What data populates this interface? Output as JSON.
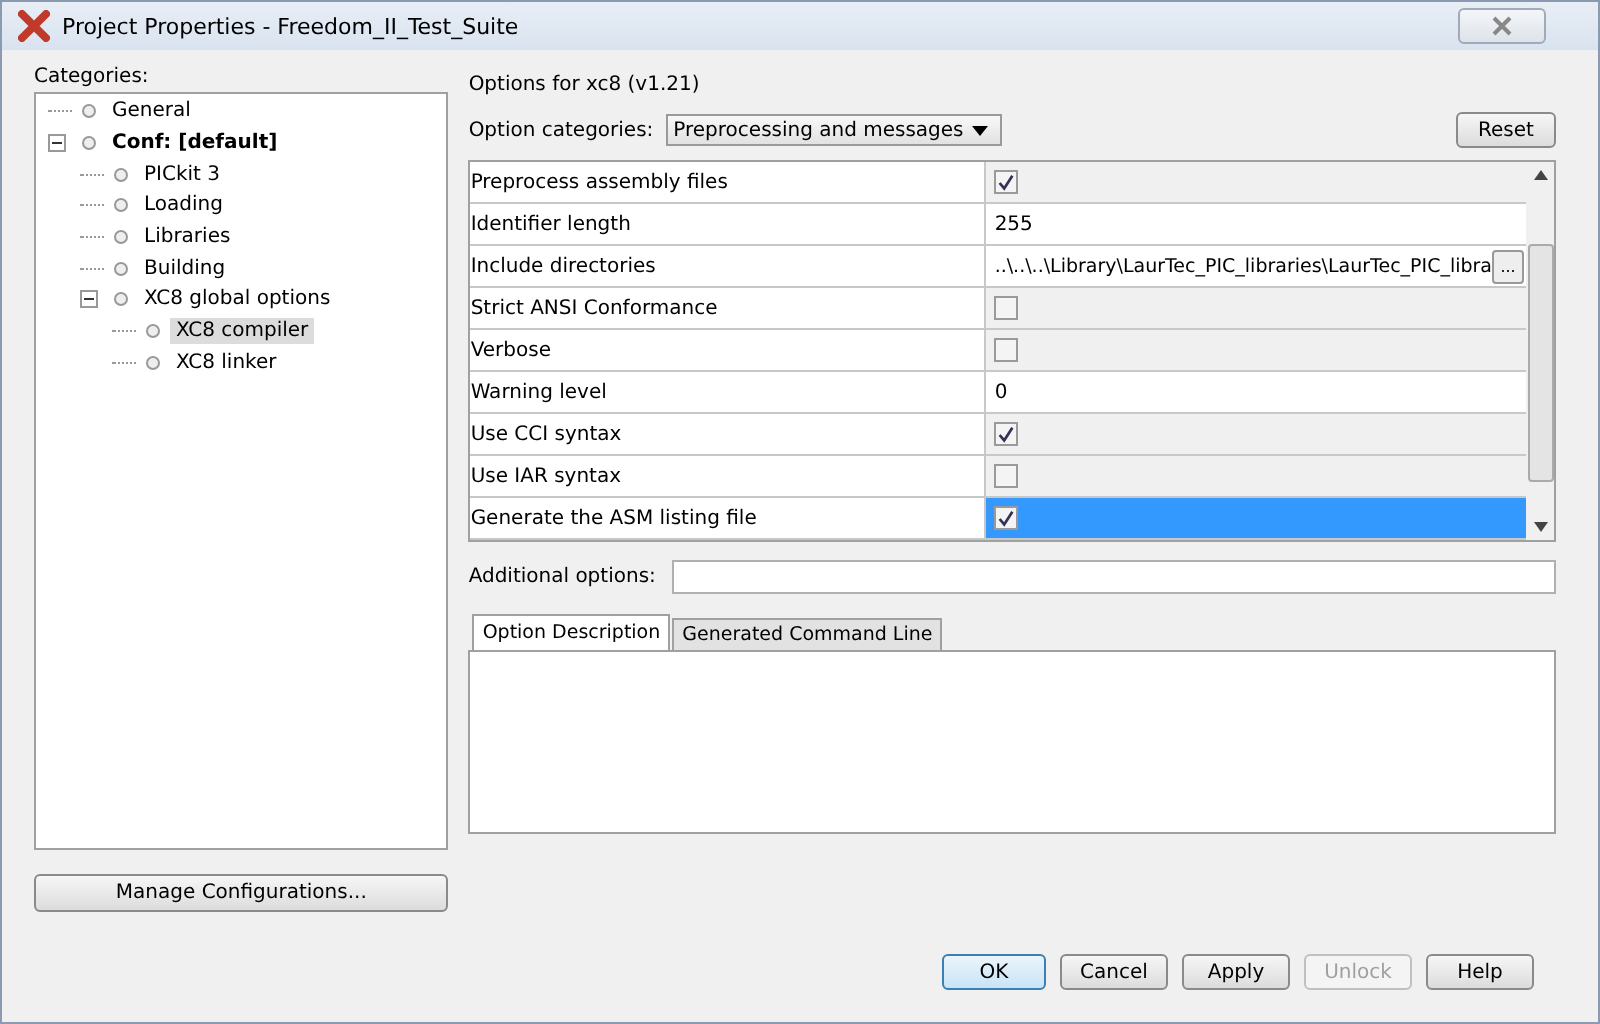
{
  "window": {
    "title": "Project Properties - Freedom_II_Test_Suite"
  },
  "categories_label": "Categories:",
  "tree": [
    {
      "label": "General",
      "bold": false,
      "selected": false
    },
    {
      "label": "Conf: [default]",
      "bold": true,
      "selected": false,
      "expanded": true,
      "children": [
        {
          "label": "PICkit 3",
          "bold": false,
          "selected": false
        },
        {
          "label": "Loading",
          "bold": false,
          "selected": false
        },
        {
          "label": "Libraries",
          "bold": false,
          "selected": false
        },
        {
          "label": "Building",
          "bold": false,
          "selected": false
        },
        {
          "label": "XC8 global options",
          "bold": false,
          "selected": false,
          "expanded": true,
          "children": [
            {
              "label": "XC8 compiler",
              "bold": false,
              "selected": true
            },
            {
              "label": "XC8 linker",
              "bold": false,
              "selected": false
            }
          ]
        }
      ]
    }
  ],
  "manage_button": "Manage Configurations...",
  "options_title": "Options for xc8 (v1.21)",
  "option_categories": {
    "label": "Option categories:",
    "value": "Preprocessing and messages"
  },
  "reset_button": "Reset",
  "options": [
    {
      "name": "Preprocess assembly files",
      "kind": "checkbox",
      "checked": true,
      "selected": false
    },
    {
      "name": "Identifier length",
      "kind": "text",
      "value": "255",
      "selected": false
    },
    {
      "name": "Include directories",
      "kind": "path",
      "value": "..\\..\\..\\Library\\LaurTec_PIC_libraries\\LaurTec_PIC_libra",
      "button": "...",
      "selected": false
    },
    {
      "name": "Strict ANSI Conformance",
      "kind": "checkbox",
      "checked": false,
      "selected": false
    },
    {
      "name": "Verbose",
      "kind": "checkbox",
      "checked": false,
      "selected": false
    },
    {
      "name": "Warning level",
      "kind": "text",
      "value": "0",
      "selected": false
    },
    {
      "name": "Use CCI syntax",
      "kind": "checkbox",
      "checked": true,
      "selected": false
    },
    {
      "name": "Use IAR syntax",
      "kind": "checkbox",
      "checked": false,
      "selected": false
    },
    {
      "name": "Generate the ASM listing file",
      "kind": "checkbox",
      "checked": true,
      "selected": true
    }
  ],
  "additional_options": {
    "label": "Additional options:"
  },
  "tabs": [
    {
      "label": "Option Description",
      "selected": true
    },
    {
      "label": "Generated Command Line",
      "selected": false
    }
  ],
  "buttons": [
    {
      "label": "OK",
      "disabled": false,
      "default": true
    },
    {
      "label": "Cancel",
      "disabled": false,
      "default": false
    },
    {
      "label": "Apply",
      "disabled": false,
      "default": false
    },
    {
      "label": "Unlock",
      "disabled": true,
      "default": false
    },
    {
      "label": "Help",
      "disabled": false,
      "default": false
    }
  ]
}
